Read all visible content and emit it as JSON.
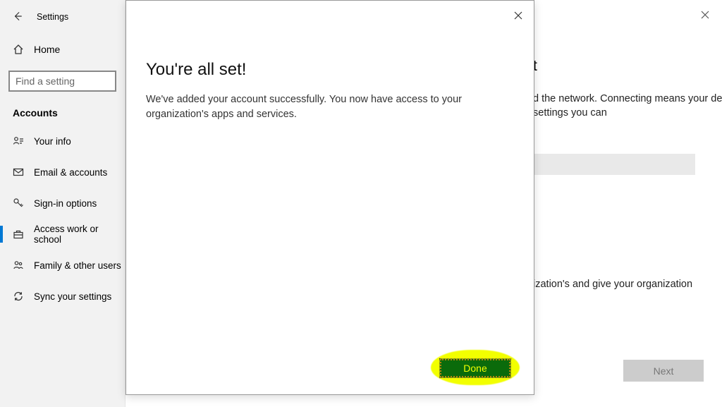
{
  "header": {
    "title": "Settings"
  },
  "sidebar": {
    "home_label": "Home",
    "search_placeholder": "Find a setting",
    "section_title": "Accounts",
    "items": [
      {
        "label": "Your info"
      },
      {
        "label": "Email & accounts"
      },
      {
        "label": "Sign-in options"
      },
      {
        "label": "Access work or school"
      },
      {
        "label": "Family & other users"
      },
      {
        "label": "Sync your settings"
      }
    ]
  },
  "dialog": {
    "title": "You're all set!",
    "body": "We've added your account successfully. You now have access to your organization's apps and services.",
    "done_label": "Done"
  },
  "background": {
    "t_char": "t",
    "line1": "d the network. Connecting means your  device, such as which settings you can",
    "line2": "ization's and give your organization",
    "next_label": "Next"
  }
}
